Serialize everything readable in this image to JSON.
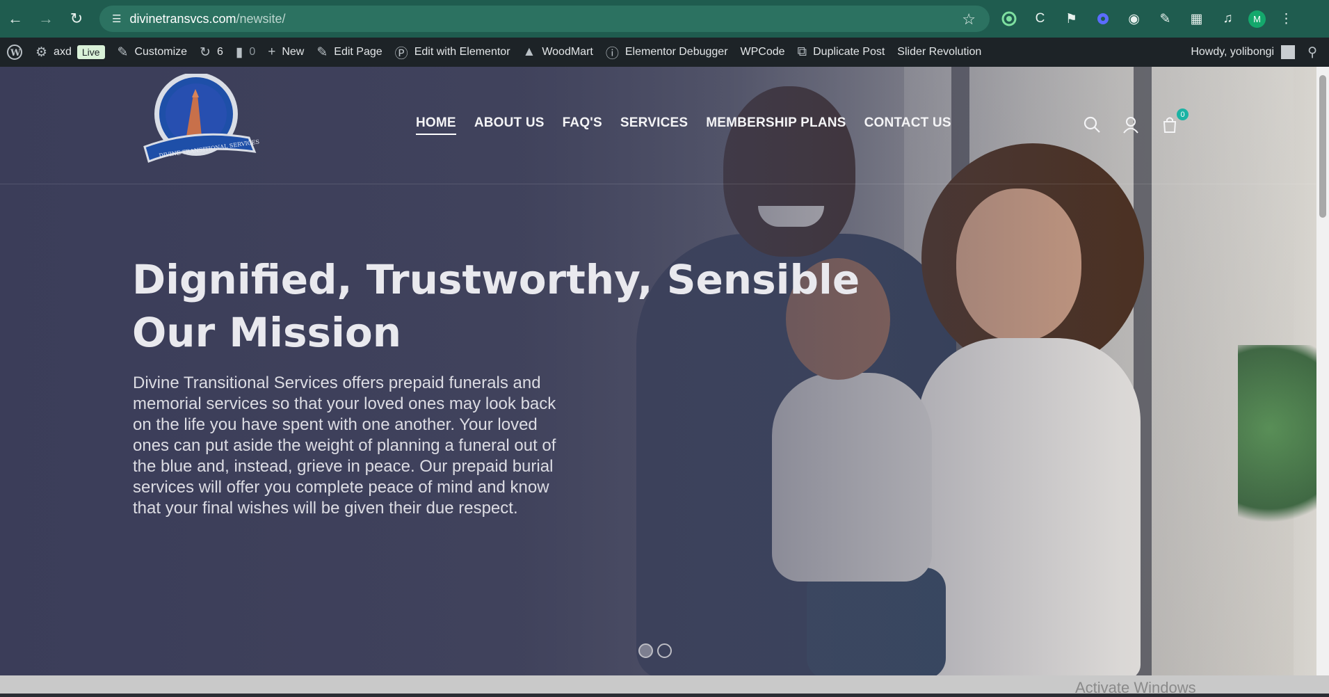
{
  "browser": {
    "url_host": "divinetransvcs.com",
    "url_path": "/newsite/",
    "profile_initial": "M"
  },
  "adminbar": {
    "site_name": "axd",
    "live_badge": "Live",
    "customize": "Customize",
    "updates_count": "6",
    "comments_count": "0",
    "new": "New",
    "edit_page": "Edit Page",
    "edit_elementor": "Edit with Elementor",
    "woodmart": "WoodMart",
    "elementor_debugger": "Elementor Debugger",
    "wpcode": "WPCode",
    "duplicate_post": "Duplicate Post",
    "slider_revolution": "Slider Revolution",
    "howdy": "Howdy, yolibongi"
  },
  "nav": {
    "items": [
      "HOME",
      "ABOUT US",
      "FAQ'S",
      "SERVICES",
      "MEMBERSHIP PLANS",
      "CONTACT US"
    ],
    "active_index": 0,
    "cart_count": "0"
  },
  "hero": {
    "title_line1": "Dignified, Trustworthy, Sensible",
    "title_line2": "Our Mission",
    "body": "Divine Transitional Services offers prepaid funerals and memorial services so that your loved ones may look back on the life you have spent with one another. Your loved ones can put aside the weight of planning a funeral out of the blue and, instead, grieve in peace. Our prepaid burial services will offer you complete peace of mind and know that your final wishes will be given their due respect.",
    "slides_total": 2,
    "active_slide": 0
  },
  "logo": {
    "banner_text": "DIVINE TRANSITIONAL SERVICES"
  },
  "system": {
    "watermark": "Activate Windows"
  },
  "colors": {
    "browser_bar": "#1f5c4f",
    "adminbar": "#1d2327",
    "cart_badge": "#1bb3a4"
  }
}
